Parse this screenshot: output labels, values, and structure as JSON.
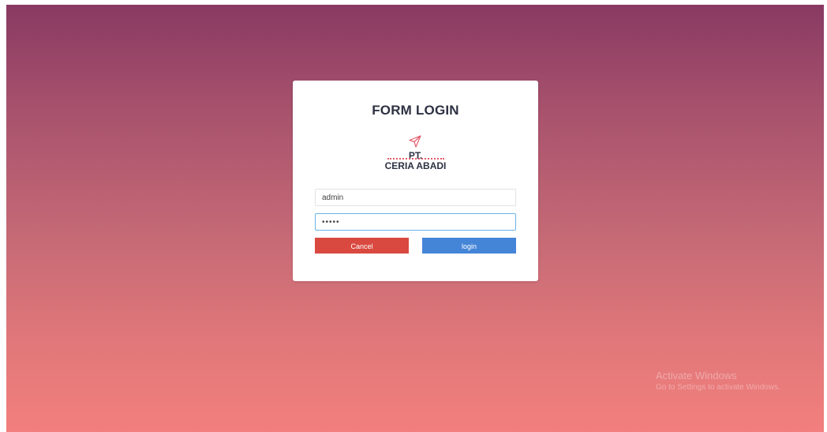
{
  "form": {
    "title": "FORM LOGIN",
    "logo": {
      "icon": "paper-plane-icon",
      "line1": "PT.",
      "line2": "CERIA ABADI"
    },
    "username_value": "admin",
    "password_masked": "•••••",
    "cancel_label": "Cancel",
    "login_label": "login"
  },
  "watermark": {
    "title": "Activate Windows",
    "subtitle": "Go to Settings to activate Windows."
  },
  "colors": {
    "gradient_top": "#893a62",
    "gradient_bottom": "#f27f7d",
    "cancel_button": "#d9493f",
    "login_button": "#4585d8",
    "input_focus_border": "#6cb3e6"
  }
}
